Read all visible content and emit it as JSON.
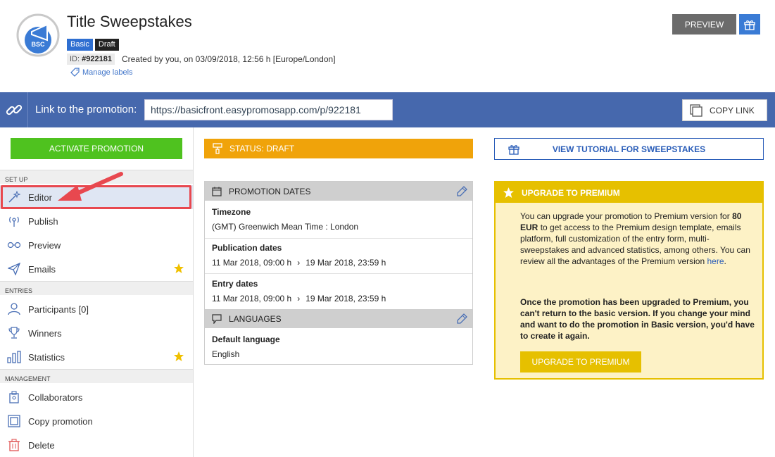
{
  "header": {
    "logo_text": "BSC",
    "title": "Title Sweepstakes",
    "badges": [
      "Basic",
      "Draft"
    ],
    "id_label": "ID:",
    "id_value": "#922181",
    "created_text": "Created by you, on 03/09/2018, 12:56 h [Europe/London]",
    "manage_labels": "Manage labels",
    "preview_label": "PREVIEW"
  },
  "linkbar": {
    "label": "Link to the promotion:",
    "url": "https://basicfront.easypromosapp.com/p/922181",
    "copy_label": "COPY LINK"
  },
  "sidebar": {
    "activate_label": "ACTIVATE PROMOTION",
    "sections": [
      {
        "title": "SET UP",
        "items": [
          {
            "label": "Editor",
            "icon": "magic-wand-icon",
            "active": true
          },
          {
            "label": "Publish",
            "icon": "broadcast-icon"
          },
          {
            "label": "Preview",
            "icon": "glasses-icon"
          },
          {
            "label": "Emails",
            "icon": "paper-plane-icon",
            "star": true
          }
        ]
      },
      {
        "title": "ENTRIES",
        "items": [
          {
            "label": "Participants [0]",
            "icon": "user-icon"
          },
          {
            "label": "Winners",
            "icon": "trophy-icon"
          },
          {
            "label": "Statistics",
            "icon": "bar-chart-icon",
            "star": true
          }
        ]
      },
      {
        "title": "MANAGEMENT",
        "items": [
          {
            "label": "Collaborators",
            "icon": "collaborators-icon"
          },
          {
            "label": "Copy promotion",
            "icon": "copy-icon"
          },
          {
            "label": "Delete",
            "icon": "trash-icon"
          }
        ]
      }
    ]
  },
  "status": {
    "label": "STATUS: DRAFT"
  },
  "dates_card": {
    "header": "PROMOTION DATES",
    "timezone_label": "Timezone",
    "timezone_value": "(GMT) Greenwich Mean Time : London",
    "publication_label": "Publication dates",
    "publication_start": "11 Mar 2018, 09:00 h",
    "publication_end": "19 Mar 2018, 23:59 h",
    "entry_label": "Entry dates",
    "entry_start": "11 Mar 2018, 09:00 h",
    "entry_end": "19 Mar 2018, 23:59 h",
    "languages_header": "LANGUAGES",
    "default_language_label": "Default language",
    "default_language_value": "English"
  },
  "tutorial": {
    "label": "VIEW TUTORIAL FOR SWEEPSTAKES"
  },
  "upgrade": {
    "header": "UPGRADE TO PREMIUM",
    "text_1": "You can upgrade your promotion to Premium version for",
    "price": "80 EUR",
    "text_2": "to get access to the Premium design template, emails platform, full customization of the entry form, multi-sweepstakes and advanced statistics, among others. You can review all the advantages of the Premium version",
    "link": "here",
    "text_3": ".",
    "warning": "Once the promotion has been upgraded to Premium, you can't return to the basic version. If you change your mind and want to do the promotion in Basic version, you'd have to create it again.",
    "button": "UPGRADE TO PREMIUM"
  },
  "colors": {
    "linkbar": "#4668ad",
    "activate": "#4fc21f",
    "status": "#f0a30a",
    "premium": "#e6c000",
    "highlight": "#e8484f"
  }
}
